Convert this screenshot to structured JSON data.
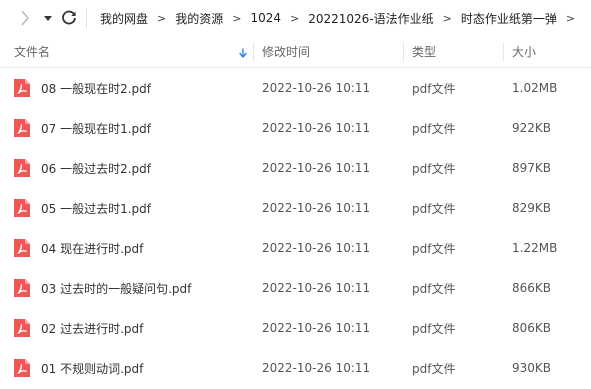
{
  "colors": {
    "pdf_icon": "#ec5a57",
    "accent": "#2d7ff9"
  },
  "toolbar": {
    "forward_icon": "chevron-right-icon",
    "dropdown_icon": "caret-down-icon",
    "refresh_icon": "refresh-icon"
  },
  "breadcrumb": [
    "我的网盘",
    "我的资源",
    "1024",
    "20221026-语法作业纸",
    "时态作业纸第一弹"
  ],
  "columns": {
    "name": "文件名",
    "modified": "修改时间",
    "type": "类型",
    "size": "大小"
  },
  "files": [
    {
      "name": "08 一般现在时2.pdf",
      "modified": "2022-10-26 10:11",
      "type": "pdf文件",
      "size": "1.02MB"
    },
    {
      "name": "07 一般现在时1.pdf",
      "modified": "2022-10-26 10:11",
      "type": "pdf文件",
      "size": "922KB"
    },
    {
      "name": "06 一般过去时2.pdf",
      "modified": "2022-10-26 10:11",
      "type": "pdf文件",
      "size": "897KB"
    },
    {
      "name": "05 一般过去时1.pdf",
      "modified": "2022-10-26 10:11",
      "type": "pdf文件",
      "size": "829KB"
    },
    {
      "name": "04 现在进行时.pdf",
      "modified": "2022-10-26 10:11",
      "type": "pdf文件",
      "size": "1.22MB"
    },
    {
      "name": "03 过去时的一般疑问句.pdf",
      "modified": "2022-10-26 10:11",
      "type": "pdf文件",
      "size": "866KB"
    },
    {
      "name": "02 过去进行时.pdf",
      "modified": "2022-10-26 10:11",
      "type": "pdf文件",
      "size": "806KB"
    },
    {
      "name": "01 不规则动词.pdf",
      "modified": "2022-10-26 10:11",
      "type": "pdf文件",
      "size": "930KB"
    }
  ]
}
